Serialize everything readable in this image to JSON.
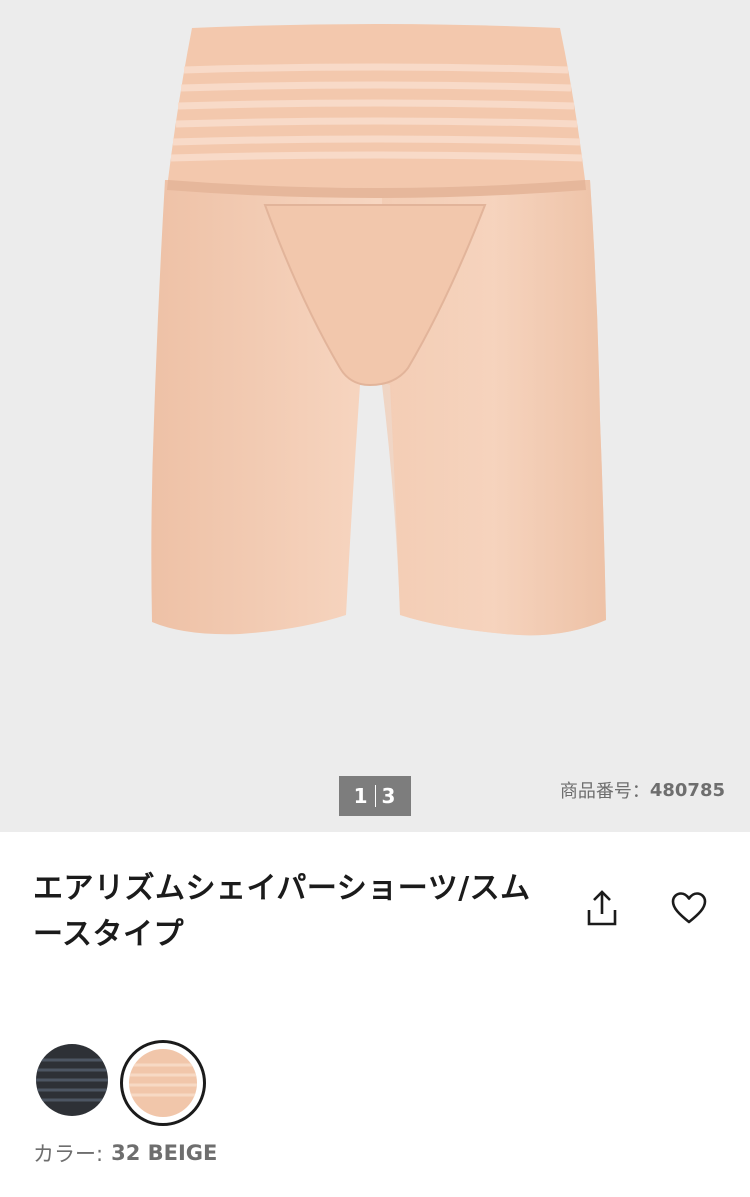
{
  "gallery": {
    "current_page": "1",
    "total_pages": "3",
    "product_code_label": "商品番号：",
    "product_code": "480785"
  },
  "product": {
    "title": "エアリズムシェイパーショーツ/スムースタイプ"
  },
  "actions": {
    "share_icon": "share-icon",
    "favorite_icon": "heart-icon"
  },
  "colors": {
    "options": [
      {
        "name": "black",
        "swatch_color": "#2e3136",
        "stripe_color": "#4d5663"
      },
      {
        "name": "beige",
        "swatch_color": "#f1c6aa",
        "stripe_color": "#f7d9c4"
      }
    ],
    "selected_label": "カラー:",
    "selected_value": "32 BEIGE"
  },
  "theme": {
    "background_gray": "#ececec",
    "garment_beige": "#f3cdb5",
    "pager_bg": "#7d7d7d"
  }
}
